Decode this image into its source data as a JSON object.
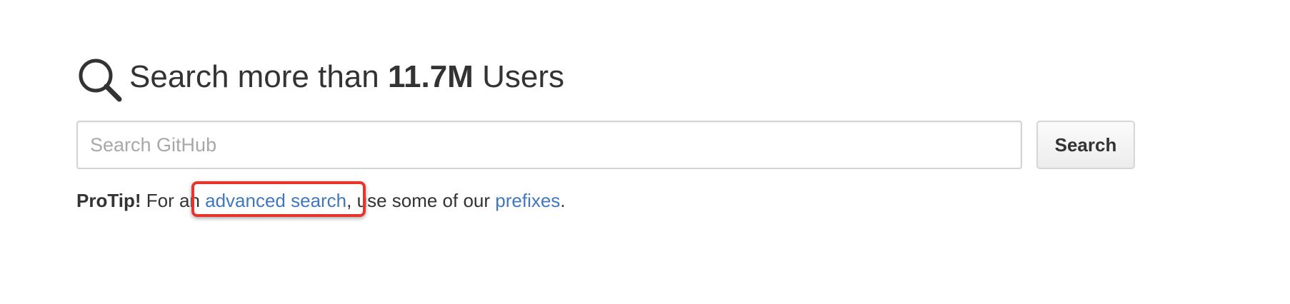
{
  "heading": {
    "prefix": "Search more than ",
    "count": "11.7M",
    "suffix": " Users",
    "icon": "search-icon"
  },
  "search": {
    "placeholder": "Search GitHub",
    "value": "",
    "button_label": "Search"
  },
  "protip": {
    "label": "ProTip!",
    "text_before_link": " For an ",
    "advanced_link": "advanced search",
    "text_between": ", use some of our ",
    "prefixes_link": "prefixes",
    "text_end": "."
  },
  "colors": {
    "link": "#4078c0",
    "highlight": "#e8342a",
    "text": "#333333"
  }
}
